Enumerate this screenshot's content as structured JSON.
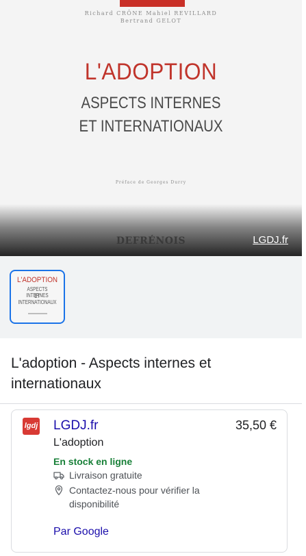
{
  "hero": {
    "authors_line1": "Richard CRÔNE   Mahiel REVILLARD",
    "authors_line2": "Bertrand GELOT",
    "cover_title": "L'ADOPTION",
    "cover_subtitle_1": "ASPECTS INTERNES",
    "cover_subtitle_2": "ET INTERNATIONAUX",
    "preface": "Préface de Georges Durry",
    "publisher": "DEFRÉNOIS",
    "source_link": "LGDJ.fr"
  },
  "thumbnail": {
    "title": "L'ADOPTION",
    "subtitle_1": "ASPECTS INTERNES",
    "subtitle_2": "ET INTERNATIONAUX"
  },
  "product": {
    "title": "L'adoption - Aspects internes et internationaux"
  },
  "offer": {
    "logo_text": "lgdj",
    "seller": "LGDJ.fr",
    "price": "35,50 €",
    "item_title": "L'adoption",
    "stock": "En stock en ligne",
    "delivery": "Livraison gratuite",
    "contact": "Contactez-nous pour vérifier la disponibilité",
    "by_google": "Par Google"
  },
  "colors": {
    "link": "#1a0dab",
    "stock_green": "#188038",
    "cover_red": "#c0342b",
    "selected_border": "#1a73e8"
  },
  "icons": {
    "delivery": "truck-icon",
    "contact": "location-pin-icon"
  }
}
